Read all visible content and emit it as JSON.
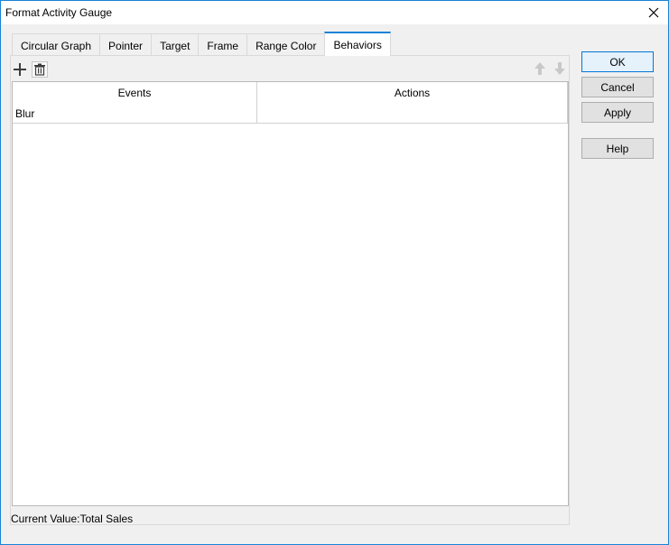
{
  "window": {
    "title": "Format Activity Gauge",
    "close_icon": "close-icon"
  },
  "tabs": [
    {
      "label": "Circular Graph",
      "active": false
    },
    {
      "label": "Pointer",
      "active": false
    },
    {
      "label": "Target",
      "active": false
    },
    {
      "label": "Frame",
      "active": false
    },
    {
      "label": "Range Color",
      "active": false
    },
    {
      "label": "Behaviors",
      "active": true
    }
  ],
  "toolbar": {
    "add_icon": "plus-icon",
    "delete_icon": "trash-icon",
    "move_up_icon": "arrow-up-icon",
    "move_down_icon": "arrow-down-icon"
  },
  "table": {
    "columns": [
      "Events",
      "Actions"
    ],
    "rows": [
      {
        "event": "Blur",
        "action": ""
      }
    ]
  },
  "status": {
    "text": "Current Value:Total Sales"
  },
  "buttons": {
    "ok": "OK",
    "cancel": "Cancel",
    "apply": "Apply",
    "help": "Help"
  },
  "colors": {
    "accent": "#1883d7",
    "window_bg": "#f0f0f0",
    "disabled_icon": "#c8c8c8"
  }
}
